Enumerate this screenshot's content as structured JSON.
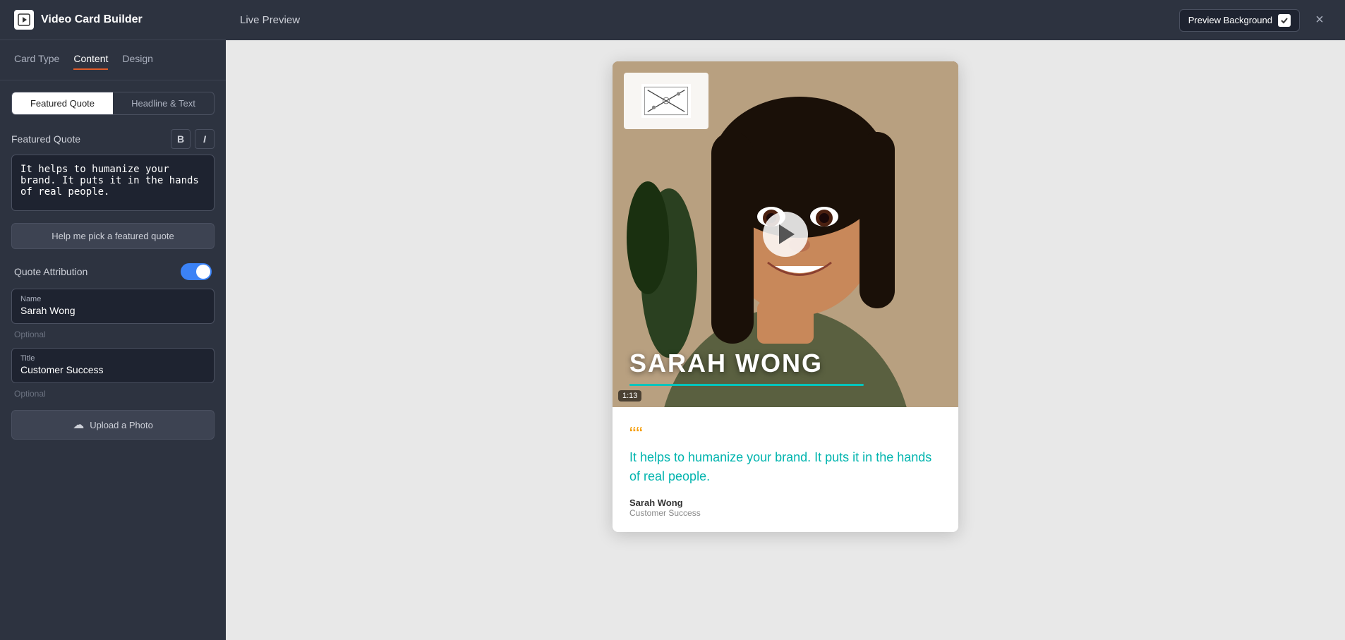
{
  "app": {
    "title": "Video Card Builder",
    "logo_icon": "▶"
  },
  "tabs": {
    "card_type": "Card Type",
    "content": "Content",
    "design": "Design",
    "active": "content"
  },
  "segments": {
    "featured_quote": "Featured Quote",
    "headline_text": "Headline & Text",
    "active": "featured_quote"
  },
  "featured_quote_section": {
    "label": "Featured Quote",
    "bold_label": "B",
    "italic_label": "I",
    "quote_text": "It helps to humanize your brand. It puts it in the hands of real people.",
    "help_button": "Help me pick a featured quote"
  },
  "quote_attribution": {
    "label": "Quote Attribution",
    "toggle_on": true
  },
  "name_field": {
    "label": "Name",
    "value": "Sarah Wong",
    "optional": "Optional"
  },
  "title_field": {
    "label": "Title",
    "value": "Customer Success",
    "optional": "Optional"
  },
  "upload": {
    "label": "Upload a Photo"
  },
  "topbar": {
    "live_preview": "Live Preview",
    "preview_background": "Preview Background"
  },
  "preview": {
    "name": "SARAH WONG",
    "duration": "1:13",
    "progress_pct": 75,
    "quote_mark": "““",
    "quote_text": "It helps to humanize your brand. It puts it in the hands of real people.",
    "attribution_name": "Sarah Wong",
    "attribution_title": "Customer Success"
  },
  "close_btn": "×"
}
